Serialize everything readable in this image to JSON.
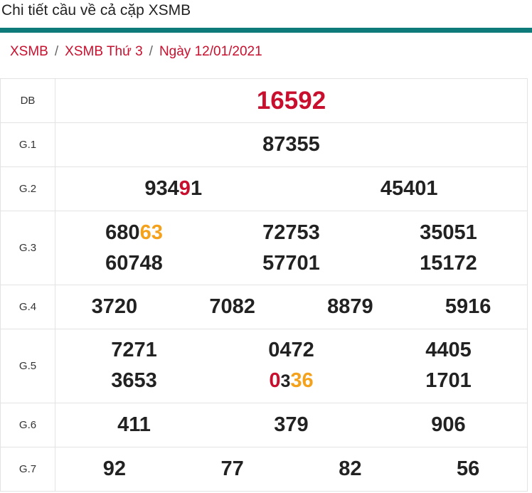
{
  "header": {
    "title": "Chi tiết cầu về cả cặp XSMB"
  },
  "breadcrumb": {
    "item1": "XSMB",
    "item2": "XSMB Thứ 3",
    "item3": "Ngày 12/01/2021",
    "separator": "/"
  },
  "colors": {
    "accent": "#0e7a7a",
    "red": "#c8102e",
    "orange": "#f4a11b"
  },
  "prizes": {
    "db": {
      "label": "DB",
      "number": "16592"
    },
    "g1": {
      "label": "G.1",
      "number": "87355"
    },
    "g2": {
      "label": "G.2",
      "n1_head": "934",
      "n1_mid": "9",
      "n1_tail": "1",
      "n2": "45401"
    },
    "g3": {
      "label": "G.3",
      "n1_head": "680",
      "n1_tail": "63",
      "n2": "72753",
      "n3": "35051",
      "n4": "60748",
      "n5": "57701",
      "n6": "15172"
    },
    "g4": {
      "label": "G.4",
      "n1": "3720",
      "n2": "7082",
      "n3": "8879",
      "n4": "5916"
    },
    "g5": {
      "label": "G.5",
      "n1": "7271",
      "n2": "0472",
      "n3": "4405",
      "n4": "3653",
      "n5_a": "0",
      "n5_b": "3",
      "n5_c": "36",
      "n6": "1701"
    },
    "g6": {
      "label": "G.6",
      "n1": "411",
      "n2": "379",
      "n3": "906"
    },
    "g7": {
      "label": "G.7",
      "n1": "92",
      "n2": "77",
      "n3": "82",
      "n4": "56"
    }
  }
}
